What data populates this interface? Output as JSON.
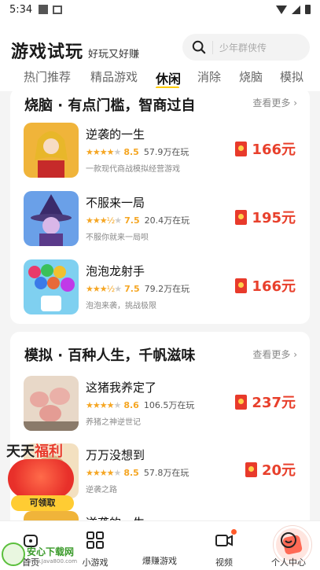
{
  "status_bar": {
    "time": "5:34"
  },
  "header": {
    "title": "游戏试玩",
    "subtitle": "好玩又好赚",
    "search_placeholder": "少年群侠传"
  },
  "tabs": [
    {
      "label": "热门推荐",
      "active": false
    },
    {
      "label": "精品游戏",
      "active": false
    },
    {
      "label": "休闲",
      "active": true
    },
    {
      "label": "消除",
      "active": false
    },
    {
      "label": "烧脑",
      "active": false
    },
    {
      "label": "模拟",
      "active": false
    }
  ],
  "sections": [
    {
      "title": "烧脑 · 有点门槛，智商过自",
      "more": "查看更多",
      "games": [
        {
          "name": "逆袭的一生",
          "score": "8.5",
          "stars": 4,
          "players": "57.9万在玩",
          "desc": "一款现代商战模拟经营游戏",
          "reward": "166元"
        },
        {
          "name": "不服来一局",
          "score": "7.5",
          "stars": 3.5,
          "players": "20.4万在玩",
          "desc": "不服你就来一局呗",
          "reward": "195元"
        },
        {
          "name": "泡泡龙射手",
          "score": "7.5",
          "stars": 3.5,
          "players": "79.2万在玩",
          "desc": "泡泡来袭，挑战极限",
          "reward": "166元"
        }
      ]
    },
    {
      "title": "模拟 · 百种人生，千帆滋味",
      "more": "查看更多",
      "games": [
        {
          "name": "这猪我养定了",
          "score": "8.6",
          "stars": 4,
          "players": "106.5万在玩",
          "desc": "养猪之神逆世记",
          "reward": "237元"
        },
        {
          "name": "万万没想到",
          "score": "8.5",
          "stars": 4,
          "players": "57.8万在玩",
          "desc": "逆袭之路",
          "reward": "20元"
        },
        {
          "name": "逆袭的一生"
        }
      ]
    }
  ],
  "promo": {
    "title_a": "天天",
    "title_b": "福利",
    "button": "可领取"
  },
  "bottom_nav": [
    {
      "label": "首页",
      "icon": "home-icon"
    },
    {
      "label": "小游戏",
      "icon": "grid-icon"
    },
    {
      "label": "爆赚游戏",
      "icon": "money-game-icon"
    },
    {
      "label": "视频",
      "icon": "video-icon"
    },
    {
      "label": "个人中心",
      "icon": "profile-icon"
    }
  ],
  "watermark": {
    "text": "安心下载网",
    "url": "www.Java800.com"
  },
  "colors": {
    "accent": "#ffcc00",
    "reward": "#e8402c",
    "star": "#f5a623"
  }
}
